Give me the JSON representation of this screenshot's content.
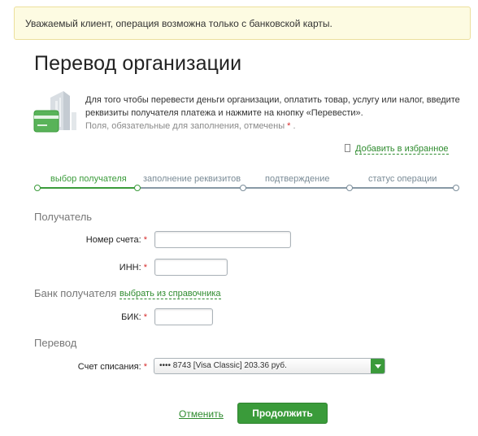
{
  "notice": {
    "text": "Уважаемый клиент, операция возможна только с банковской карты."
  },
  "page_title": "Перевод организации",
  "intro": {
    "text": "Для того чтобы перевести деньги организации, оплатить товар, услугу или налог, введите реквизиты получателя платежа и нажмите на кнопку «Перевести».",
    "required_note": "Поля, обязательные для заполнения, отмечены",
    "required_star": "*",
    "required_end": "."
  },
  "favorites": {
    "label": "Добавить в избранное",
    "icon": "bookmark-icon"
  },
  "steps": [
    {
      "label": "выбор получателя",
      "state": "active"
    },
    {
      "label": "заполнение реквизитов",
      "state": "pending"
    },
    {
      "label": "подтверждение",
      "state": "pending"
    },
    {
      "label": "статус операции",
      "state": "pending"
    }
  ],
  "sections": {
    "recipient": "Получатель",
    "bank": "Банк получателя",
    "bank_link": "выбрать из справочника",
    "transfer": "Перевод"
  },
  "fields": {
    "account": {
      "label": "Номер счета:",
      "value": ""
    },
    "inn": {
      "label": "ИНН:",
      "value": ""
    },
    "bik": {
      "label": "БИК:",
      "value": ""
    },
    "debit_account": {
      "label": "Счет списания:",
      "value": "•••• 8743 [Visa Classic] 203.36 руб."
    }
  },
  "required_star": "*",
  "buttons": {
    "cancel": "Отменить",
    "continue": "Продолжить"
  },
  "colors": {
    "accent": "#3a9b3a",
    "notice_bg": "#fdfbe2",
    "required": "#d62b2b",
    "step_line": "#8899a5"
  }
}
